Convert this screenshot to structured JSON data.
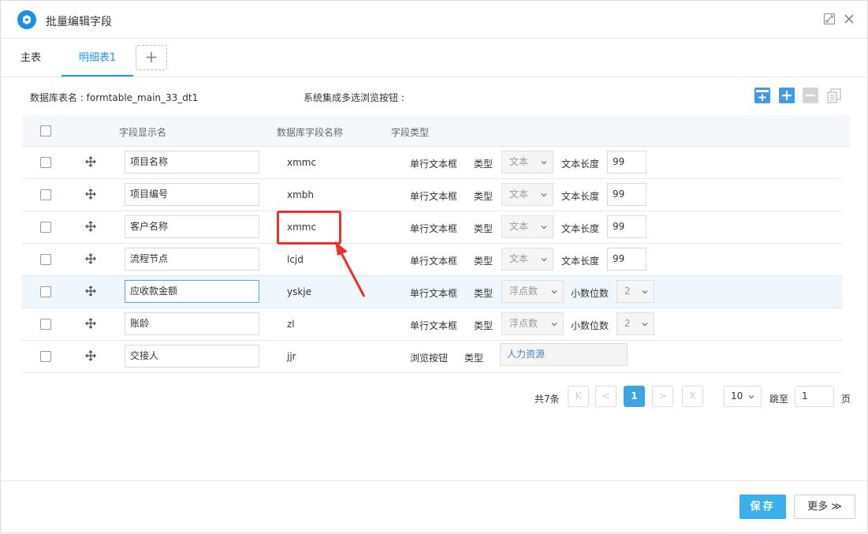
{
  "window": {
    "title": "批量编辑字段"
  },
  "tabs": [
    {
      "label": "主表"
    },
    {
      "label": "明细表1"
    }
  ],
  "info": {
    "db_table_label": "数据库表名 : formtable_main_33_dt1",
    "browse_label": "系统集成多选浏览按钮 :"
  },
  "table": {
    "headers": {
      "display_name": "字段显示名",
      "db_name": "数据库字段名称",
      "field_type": "字段类型"
    },
    "rows": [
      {
        "display": "项目名称",
        "db": "xmmc",
        "type": "单行文本框",
        "type_label": "类型",
        "subtype": "文本",
        "param_label": "文本长度",
        "param": "99"
      },
      {
        "display": "项目编号",
        "db": "xmbh",
        "type": "单行文本框",
        "type_label": "类型",
        "subtype": "文本",
        "param_label": "文本长度",
        "param": "99"
      },
      {
        "display": "客户名称",
        "db": "xmmc",
        "type": "单行文本框",
        "type_label": "类型",
        "subtype": "文本",
        "param_label": "文本长度",
        "param": "99"
      },
      {
        "display": "流程节点",
        "db": "lcjd",
        "type": "单行文本框",
        "type_label": "类型",
        "subtype": "文本",
        "param_label": "文本长度",
        "param": "99"
      },
      {
        "display": "应收款金额",
        "db": "yskje",
        "type": "单行文本框",
        "type_label": "类型",
        "subtype": "浮点数",
        "param_label": "小数位数",
        "param": "2"
      },
      {
        "display": "账龄",
        "db": "zl",
        "type": "单行文本框",
        "type_label": "类型",
        "subtype": "浮点数",
        "param_label": "小数位数",
        "param": "2"
      },
      {
        "display": "交接人",
        "db": "jjr",
        "type": "浏览按钮",
        "type_label": "类型",
        "browse_value": "人力资源"
      }
    ]
  },
  "pagination": {
    "total": "共7条",
    "current_page": "1",
    "page_size": "10",
    "jump_label": "跳至",
    "jump_value": "1",
    "page_suffix": "页",
    "first": "K",
    "prev": "<",
    "next": ">",
    "last": "X"
  },
  "footer": {
    "save_label": "保存",
    "more_label": "更多 ≫"
  },
  "colors": {
    "accent": "#2196f3",
    "save": "#3ab0ea",
    "highlight": "#f0312a"
  }
}
